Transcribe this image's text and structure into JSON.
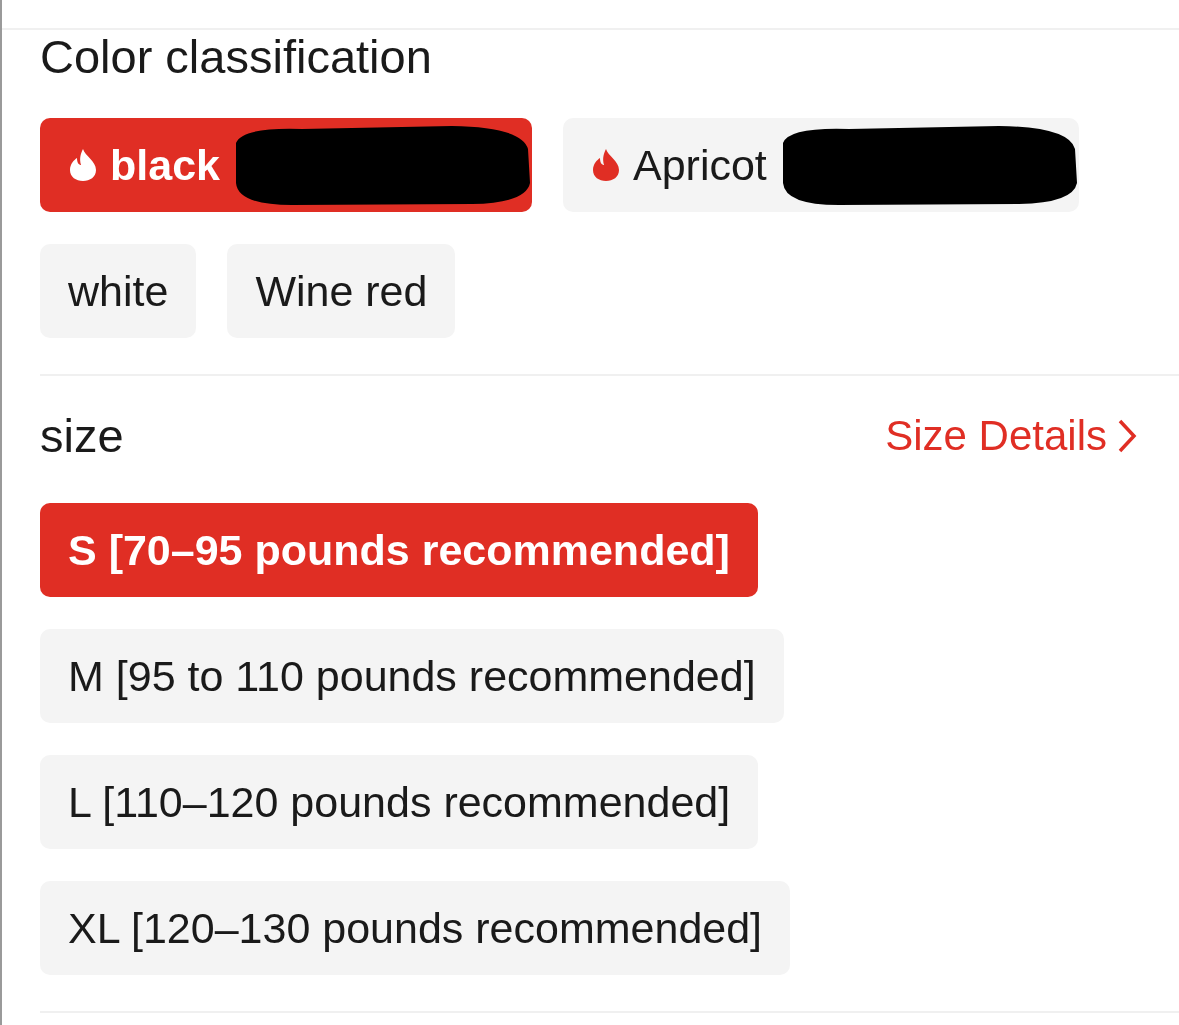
{
  "color_section": {
    "title": "Color classification",
    "options": [
      {
        "label": "black",
        "hot": true,
        "selected": true,
        "redacted": true
      },
      {
        "label": "Apricot",
        "hot": true,
        "selected": false,
        "redacted": true
      },
      {
        "label": "white",
        "hot": false,
        "selected": false,
        "redacted": false
      },
      {
        "label": "Wine red",
        "hot": false,
        "selected": false,
        "redacted": false
      }
    ]
  },
  "size_section": {
    "title": "size",
    "details_link": "Size Details",
    "options": [
      {
        "label": "S [70–95 pounds recommended]",
        "selected": true
      },
      {
        "label": "M [95 to 110 pounds recommended]",
        "selected": false
      },
      {
        "label": "L [110–120 pounds recommended]",
        "selected": false
      },
      {
        "label": "XL [120–130 pounds recommended]",
        "selected": false
      }
    ]
  }
}
